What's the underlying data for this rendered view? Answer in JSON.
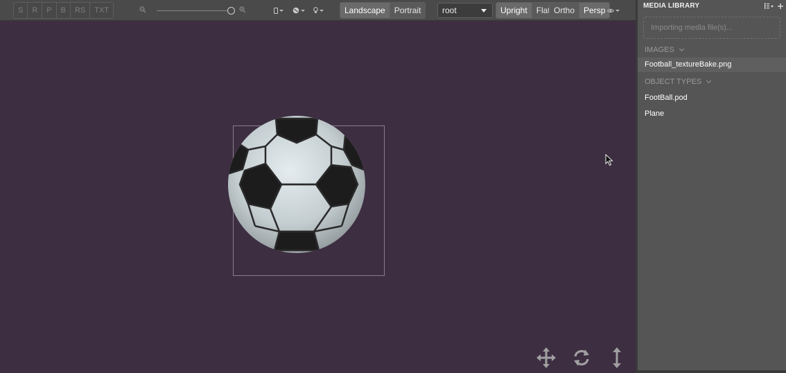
{
  "toolbar": {
    "render_modes": [
      "S",
      "R",
      "P",
      "B",
      "RS",
      "TXT"
    ],
    "orientation": [
      {
        "label": "Landscape",
        "active": true
      },
      {
        "label": "Portrait",
        "active": false
      }
    ],
    "root_select": "root",
    "upright_flat": [
      {
        "label": "Upright",
        "active": true
      },
      {
        "label": "Flat",
        "active": false
      }
    ],
    "projection": [
      {
        "label": "Ortho",
        "active": false
      },
      {
        "label": "Persp",
        "active": true
      }
    ],
    "icons": {
      "zoom_out": "zoom-out-icon",
      "zoom_in": "zoom-in-icon",
      "device": "device-icon",
      "globe": "globe-icon",
      "light": "light-bulb-icon",
      "eye": "eye-icon"
    }
  },
  "viewport": {
    "background": "#3d2e42",
    "tools": [
      "move-icon",
      "rotate-icon",
      "scale-vertical-icon"
    ]
  },
  "media_library": {
    "title": "MEDIA LIBRARY",
    "import_status": "Importing media file(s)...",
    "sections": [
      {
        "title": "IMAGES",
        "items": [
          {
            "label": "Football_textureBake.png",
            "selected": true
          }
        ]
      },
      {
        "title": "OBJECT TYPES",
        "items": [
          {
            "label": "FootBall.pod",
            "selected": false
          },
          {
            "label": "Plane",
            "selected": false
          }
        ]
      }
    ]
  }
}
